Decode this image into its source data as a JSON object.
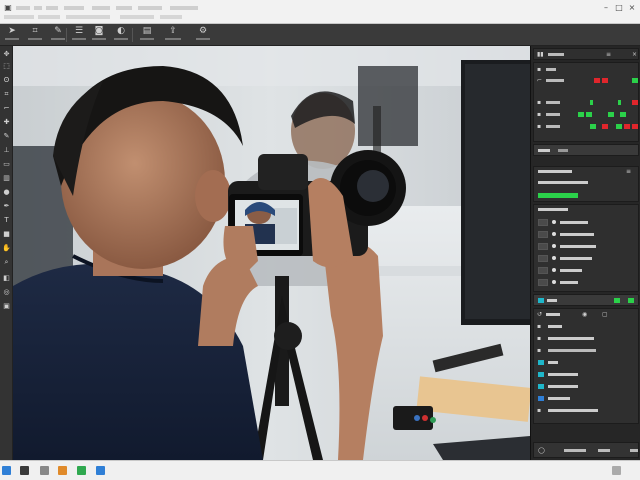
{
  "titlebar": {
    "window_controls": [
      "minimize-icon",
      "maximize-icon",
      "close-icon"
    ]
  },
  "toolbar": {
    "tools": [
      {
        "icon": "pointer-icon"
      },
      {
        "icon": "crop-icon"
      },
      {
        "icon": "brush-icon"
      },
      {
        "icon": "layers-icon"
      },
      {
        "icon": "camera-icon"
      },
      {
        "icon": "adjust-icon"
      },
      {
        "icon": "folder-icon"
      },
      {
        "icon": "settings-icon"
      }
    ]
  },
  "left_tools": [
    "move-icon",
    "marquee-icon",
    "lasso-icon",
    "crop-icon",
    "eyedropper-icon",
    "heal-icon",
    "brush-icon",
    "stamp-icon",
    "eraser-icon",
    "gradient-icon",
    "dodge-icon",
    "pen-icon",
    "type-icon",
    "shape-icon",
    "hand-icon",
    "zoom-icon",
    "color-swatch-icon",
    "mask-icon",
    "screen-mode-icon"
  ],
  "colors": {
    "green": "#2bd14a",
    "red": "#e0262c",
    "teal": "#1fb6c9",
    "accent_blue": "#2f7fd6"
  },
  "layer_visibility": [
    true,
    true,
    true,
    true,
    true,
    true
  ]
}
